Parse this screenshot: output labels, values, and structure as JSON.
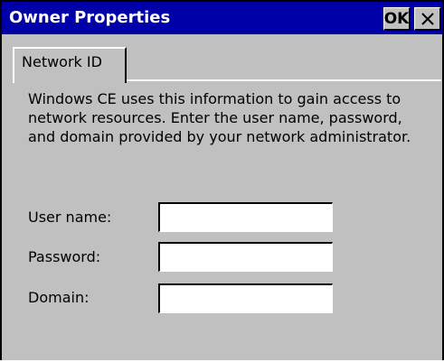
{
  "window": {
    "title": "Owner Properties",
    "ok_label": "OK",
    "close_icon": "close-x"
  },
  "tabs": [
    {
      "label": "Network ID",
      "selected": true
    }
  ],
  "network_id": {
    "description": "Windows CE uses this information to gain access to network resources. Enter the user name, password, and domain provided by your network administrator.",
    "fields": {
      "user_name": {
        "label": "User name:",
        "value": ""
      },
      "password": {
        "label": "Password:",
        "value": ""
      },
      "domain": {
        "label": "Domain:",
        "value": ""
      }
    }
  },
  "colors": {
    "titlebar": "#0000a8",
    "title_text": "#ffffff",
    "face": "#c0c0c0",
    "input_bg": "#ffffff"
  }
}
